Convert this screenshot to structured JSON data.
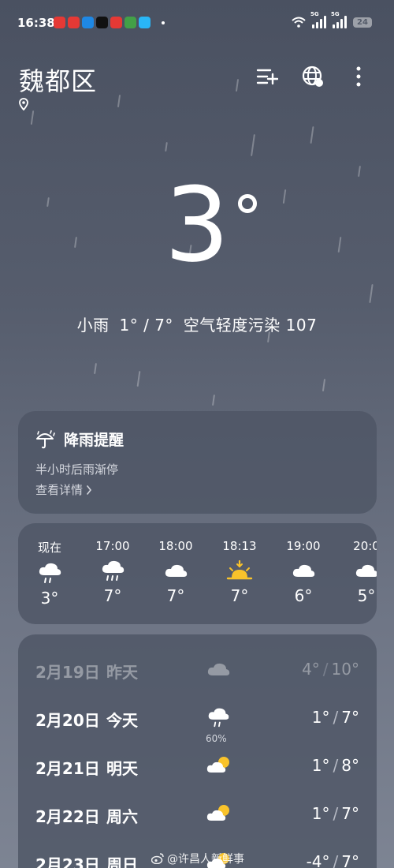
{
  "status_bar": {
    "time": "16:38",
    "notification_colors": [
      "#e53935",
      "#e53935",
      "#1e88e5",
      "#111111",
      "#e53935",
      "#43a047",
      "#29b6f6"
    ],
    "network_tag_1": "5G",
    "network_tag_2": "5G",
    "battery": "24"
  },
  "header": {
    "city": "魏都区",
    "icons": [
      "manage-cities-icon",
      "globe-icon",
      "more-icon",
      "location-icon"
    ]
  },
  "current": {
    "temperature": "3",
    "condition": "小雨",
    "range": "1° / 7°",
    "air_quality": "空气轻度污染 107"
  },
  "rain_alert": {
    "title": "降雨提醒",
    "subtitle": "半小时后雨渐停",
    "link": "查看详情"
  },
  "hourly": [
    {
      "label": "现在",
      "icon": "rain-cloud",
      "temp": "3°"
    },
    {
      "label": "17:00",
      "icon": "rain-cloud",
      "temp": "7°"
    },
    {
      "label": "18:00",
      "icon": "cloud",
      "temp": "7°"
    },
    {
      "label": "18:13",
      "icon": "sunset",
      "temp": "7°"
    },
    {
      "label": "19:00",
      "icon": "cloud",
      "temp": "6°"
    },
    {
      "label": "20:0",
      "icon": "cloud",
      "temp": "5°"
    }
  ],
  "daily": [
    {
      "date": "2月19日",
      "day": "昨天",
      "icon": "cloud",
      "prob": "",
      "low": "4°",
      "high": "10°"
    },
    {
      "date": "2月20日",
      "day": "今天",
      "icon": "rain-cloud",
      "prob": "60%",
      "low": "1°",
      "high": "7°"
    },
    {
      "date": "2月21日",
      "day": "明天",
      "icon": "partly-cloudy",
      "prob": "",
      "low": "1°",
      "high": "8°"
    },
    {
      "date": "2月22日",
      "day": "周六",
      "icon": "partly-cloudy",
      "prob": "",
      "low": "1°",
      "high": "7°"
    },
    {
      "date": "2月23日",
      "day": "周日",
      "icon": "partly-cloudy",
      "prob": "",
      "low": "-4°",
      "high": "7°"
    }
  ],
  "watermark": "@许昌人新鲜事",
  "colors": {
    "background_top": "#4a5161",
    "background_bottom": "#7d8493",
    "card": "#4e5565",
    "sun": "#f9c32b"
  }
}
